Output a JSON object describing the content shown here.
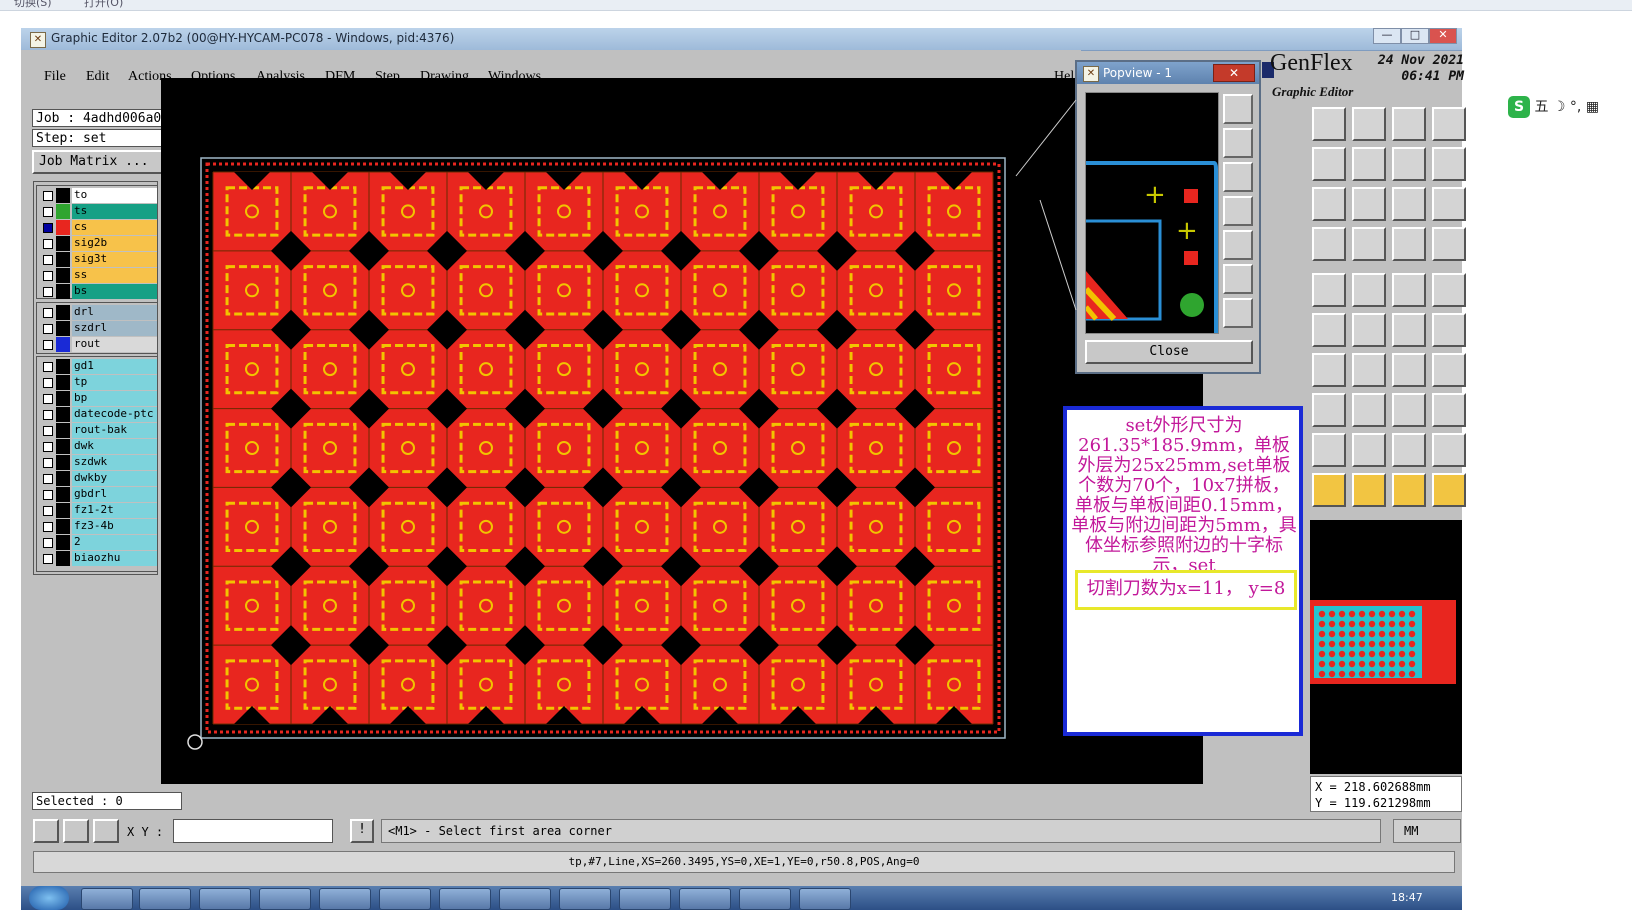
{
  "top_strip": {
    "left_text": "切换(S)",
    "right_text": "打开(O)"
  },
  "window": {
    "title": "Graphic Editor 2.07b2 (00@HY-HYCAM-PC078 - Windows, pid:4376)",
    "controls": [
      "—",
      "□",
      "✕"
    ]
  },
  "menu": [
    "File",
    "Edit",
    "Actions",
    "Options",
    "Analysis",
    "DFM",
    "Step",
    "Drawing",
    "Windows",
    "Help"
  ],
  "job": {
    "job_label": "Job : 4adhd006a0",
    "step_label": "Step: set",
    "matrix_button": "Job Matrix ..."
  },
  "layers_group1": [
    {
      "name": "to",
      "color": "#ffffff",
      "swatch": "#000000"
    },
    {
      "name": "ts",
      "color": "#16a085",
      "swatch": "#2fa52f"
    },
    {
      "name": "cs",
      "color": "#f7c24a",
      "swatch": "#e8261f",
      "selected": true
    },
    {
      "name": "sig2b",
      "color": "#f7c24a",
      "swatch": "#000000"
    },
    {
      "name": "sig3t",
      "color": "#f7c24a",
      "swatch": "#000000"
    },
    {
      "name": "ss",
      "color": "#f7c24a",
      "swatch": "#000000"
    },
    {
      "name": "bs",
      "color": "#16a085",
      "swatch": "#000000"
    }
  ],
  "layers_group2": [
    {
      "name": "drl",
      "color": "#9fb8c8",
      "swatch": "#000000"
    },
    {
      "name": "szdrl",
      "color": "#9fb8c8",
      "swatch": "#000000"
    },
    {
      "name": "rout",
      "color": "#d9d9d9",
      "swatch": "#1a2ad6"
    }
  ],
  "layers_group3": [
    {
      "name": "gd1",
      "color": "#7dd3dc",
      "swatch": "#000000"
    },
    {
      "name": "tp",
      "color": "#7dd3dc",
      "swatch": "#000000"
    },
    {
      "name": "bp",
      "color": "#7dd3dc",
      "swatch": "#000000"
    },
    {
      "name": "datecode-ptc",
      "color": "#7dd3dc",
      "swatch": "#000000"
    },
    {
      "name": "rout-bak",
      "color": "#7dd3dc",
      "swatch": "#000000"
    },
    {
      "name": "dwk",
      "color": "#7dd3dc",
      "swatch": "#000000"
    },
    {
      "name": "szdwk",
      "color": "#7dd3dc",
      "swatch": "#000000"
    },
    {
      "name": "dwkby",
      "color": "#7dd3dc",
      "swatch": "#000000"
    },
    {
      "name": "gbdrl",
      "color": "#7dd3dc",
      "swatch": "#000000"
    },
    {
      "name": "fz1-2t",
      "color": "#7dd3dc",
      "swatch": "#000000"
    },
    {
      "name": "fz3-4b",
      "color": "#7dd3dc",
      "swatch": "#000000"
    },
    {
      "name": "2",
      "color": "#7dd3dc",
      "swatch": "#000000"
    },
    {
      "name": "biaozhu",
      "color": "#7dd3dc",
      "swatch": "#000000"
    }
  ],
  "selected_label": "Selected : 0",
  "popview": {
    "title": "Popview - 1",
    "close_label": "Close"
  },
  "brand": {
    "title": "GenFlex",
    "subtitle": "Graphic Editor",
    "date": "24 Nov 2021",
    "time": "06:41 PM"
  },
  "note": {
    "text": "set外形尺寸为261.35*185.9mm，单板外层为25x25mm,set单板个数为70个，10x7拼板，单板与单板间距0.15mm，单板与附边间距为5mm，具体坐标参照附边的十字标示，set",
    "highlight": "切割刀数为x=11， y=8"
  },
  "coords": {
    "x": "X = 218.602688mm",
    "y": "Y = 119.621298mm"
  },
  "command": {
    "xy_label": "X Y :",
    "xy_value": "",
    "prompt": "<M1> - Select first area corner",
    "unit": "MM"
  },
  "status_line": "tp,#7,Line,XS=260.3495,YS=0,XE=1,YE=0,r50.8,POS,Ang=0",
  "clock": "18:47",
  "ime_text": "五",
  "colors": {
    "board": "#e8261f",
    "ring": "#f2c400",
    "diamond": "#000000",
    "outline": "#9fb8c8"
  }
}
